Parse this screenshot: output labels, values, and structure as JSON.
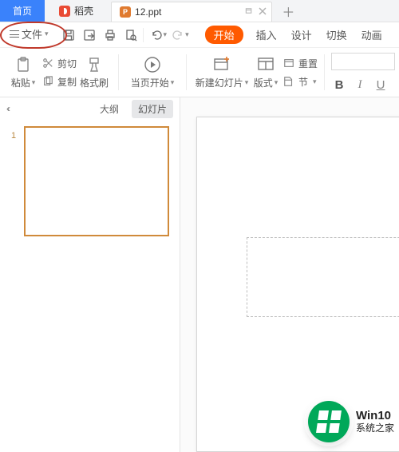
{
  "tabs": {
    "home": "首页",
    "daoke": {
      "label": "稻壳",
      "icon_name": "daoke-icon"
    },
    "doc": {
      "label": "12.ppt",
      "icon_name": "ppt-icon"
    },
    "new_tab_glyph": "＋"
  },
  "file_menu": {
    "label": "文件"
  },
  "quick": {
    "save_icon": "save-icon",
    "save_as_icon": "save-as-icon",
    "print_icon": "print-icon",
    "preview_icon": "print-preview-icon"
  },
  "undo_redo": {
    "undo_icon": "undo-icon",
    "redo_icon": "redo-icon"
  },
  "ribbon": {
    "start": "开始",
    "insert": "插入",
    "design": "设计",
    "transition": "切换",
    "animation": "动画"
  },
  "tools": {
    "paste": "粘贴",
    "cut": "剪切",
    "copy": "复制",
    "format_painter": "格式刷",
    "from_current": "当页开始",
    "new_slide": "新建幻灯片",
    "layout": "版式",
    "section": "节",
    "reset": "重置",
    "reset_icon_label": "重置"
  },
  "format": {
    "bold": "B",
    "italic": "I",
    "underline": "U"
  },
  "left_panel": {
    "outline": "大纲",
    "slides": "幻灯片",
    "slide_number": "1"
  },
  "overlay": {
    "line1": "Win10",
    "line2": "系统之家"
  }
}
